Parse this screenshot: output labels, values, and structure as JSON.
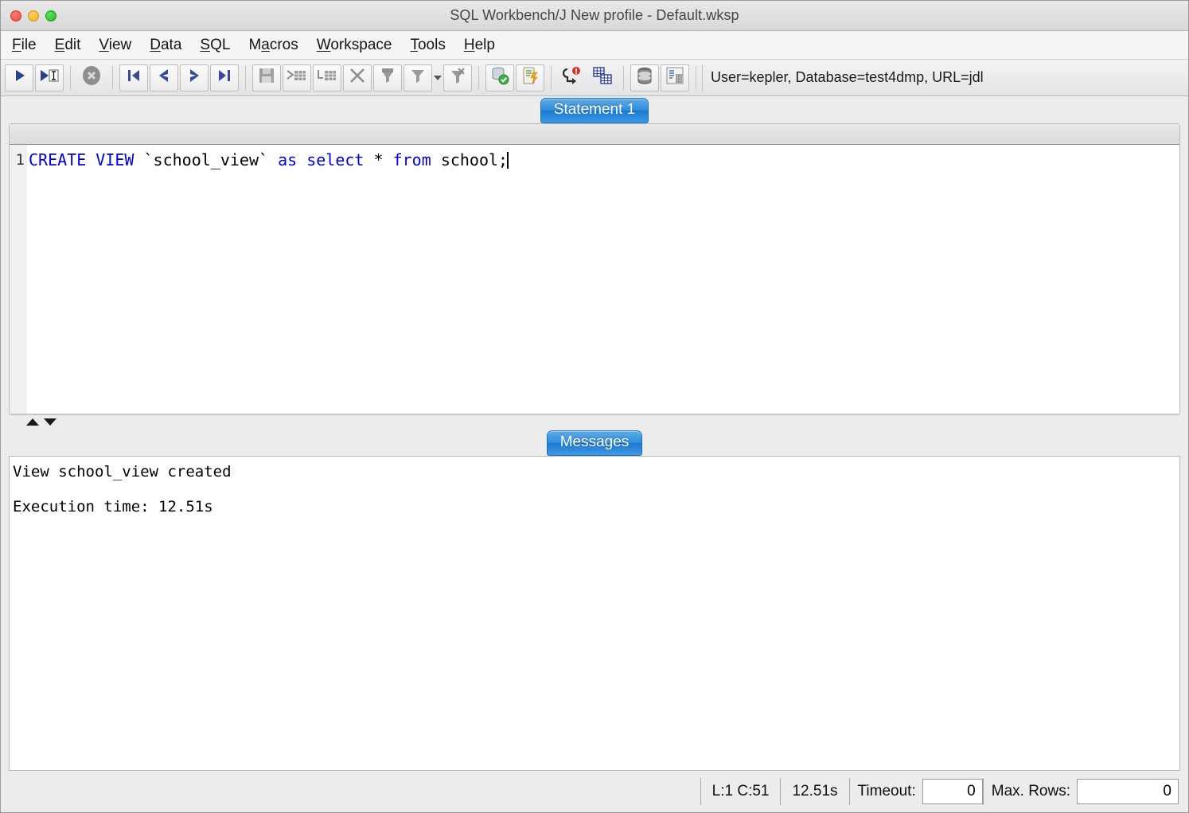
{
  "window": {
    "title": "SQL Workbench/J New profile - Default.wksp",
    "traffic_lights": [
      "close",
      "minimize",
      "zoom"
    ]
  },
  "menubar": {
    "items": [
      {
        "label": "File",
        "mnemonic": "F"
      },
      {
        "label": "Edit",
        "mnemonic": "E"
      },
      {
        "label": "View",
        "mnemonic": "V"
      },
      {
        "label": "Data",
        "mnemonic": "D"
      },
      {
        "label": "SQL",
        "mnemonic": "S"
      },
      {
        "label": "Macros",
        "mnemonic": "a"
      },
      {
        "label": "Workspace",
        "mnemonic": "W"
      },
      {
        "label": "Tools",
        "mnemonic": "T"
      },
      {
        "label": "Help",
        "mnemonic": "H"
      }
    ]
  },
  "toolbar": {
    "buttons": [
      {
        "name": "execute-all-icon",
        "enabled": true
      },
      {
        "name": "execute-current-icon",
        "enabled": true
      },
      {
        "name": "stop-icon",
        "enabled": false
      },
      {
        "name": "first-statement-icon",
        "enabled": true
      },
      {
        "name": "previous-statement-icon",
        "enabled": true
      },
      {
        "name": "next-statement-icon",
        "enabled": true
      },
      {
        "name": "last-statement-icon",
        "enabled": true
      },
      {
        "name": "save-data-icon",
        "enabled": false
      },
      {
        "name": "insert-row-icon",
        "enabled": false
      },
      {
        "name": "copy-row-icon",
        "enabled": false
      },
      {
        "name": "delete-row-icon",
        "enabled": false
      },
      {
        "name": "filter-data-icon",
        "enabled": false
      },
      {
        "name": "quick-filter-icon",
        "enabled": false
      },
      {
        "name": "reset-filter-icon",
        "enabled": false
      },
      {
        "name": "commit-icon",
        "enabled": true
      },
      {
        "name": "rollback-icon",
        "enabled": true
      },
      {
        "name": "ignore-errors-icon",
        "enabled": true
      },
      {
        "name": "append-results-icon",
        "enabled": true
      },
      {
        "name": "database-explorer-icon",
        "enabled": true
      },
      {
        "name": "object-info-icon",
        "enabled": true
      }
    ],
    "connection_status": "User=kepler, Database=test4dmp, URL=jdl"
  },
  "editor": {
    "tab_label": "Statement 1",
    "line_numbers": [
      "1"
    ],
    "statement_tokens": [
      {
        "text": "CREATE VIEW ",
        "type": "keyword"
      },
      {
        "text": "`school_view` ",
        "type": "identifier"
      },
      {
        "text": "as select ",
        "type": "keyword"
      },
      {
        "text": "* ",
        "type": "identifier"
      },
      {
        "text": "from ",
        "type": "keyword"
      },
      {
        "text": "school;",
        "type": "identifier"
      }
    ],
    "statement_plain": "CREATE VIEW `school_view` as select * from school;"
  },
  "messages": {
    "tab_label": "Messages",
    "text": "View school_view created\n\nExecution time: 12.51s"
  },
  "statusbar": {
    "cursor_position": "L:1 C:51",
    "execution_time": "12.51s",
    "timeout_label": "Timeout:",
    "timeout_value": "0",
    "max_rows_label": "Max. Rows:",
    "max_rows_value": "0"
  },
  "colors": {
    "tab_blue": "#2f8ddb",
    "keyword_blue": "#0000e0",
    "window_chrome": "#ececec",
    "traffic_red": "#f04a3f",
    "traffic_yellow": "#f2ae22",
    "traffic_green": "#1eb81e"
  }
}
